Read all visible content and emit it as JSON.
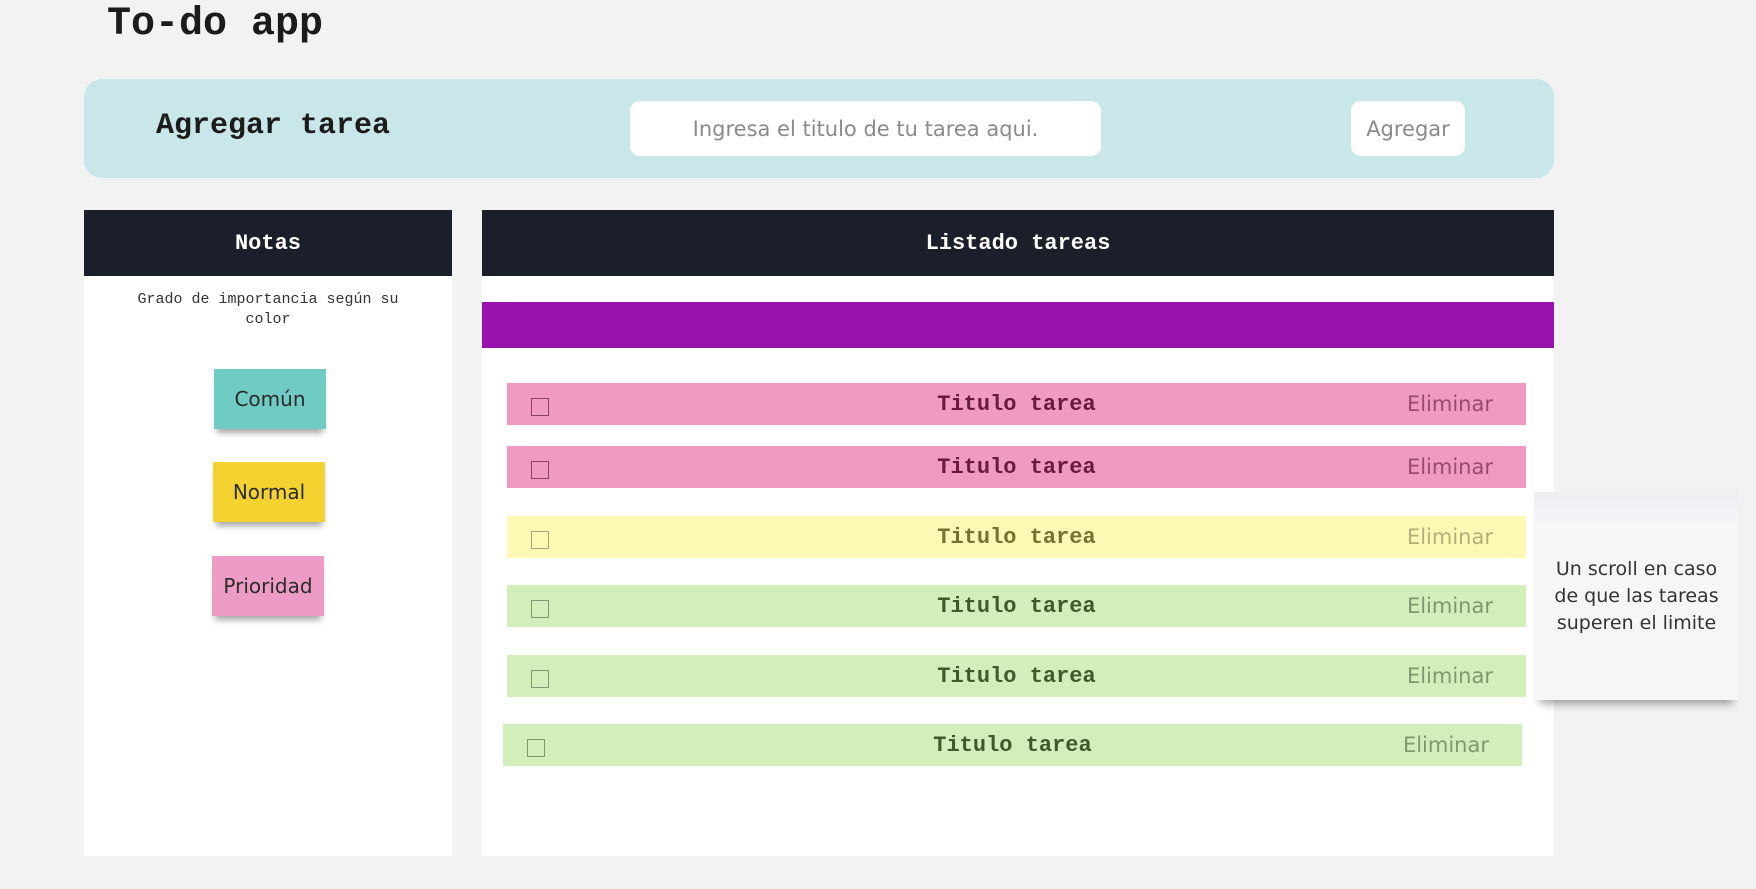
{
  "app": {
    "title": "To-do app"
  },
  "add_task": {
    "label": "Agregar tarea",
    "input_placeholder": "Ingresa el titulo de tu tarea aqui.",
    "input_value": "",
    "button_label": "Agregar"
  },
  "notes": {
    "header": "Notas",
    "description": "Grado de importancia según su color",
    "legend": [
      {
        "label": "Común",
        "color": "#6fcbc3"
      },
      {
        "label": "Normal",
        "color": "#f4d330"
      },
      {
        "label": "Prioridad",
        "color": "#ec9cc4"
      }
    ]
  },
  "tasks": {
    "header": "Listado tareas",
    "accent_color": "#9812ad",
    "items": [
      {
        "title": "Titulo tarea",
        "delete_label": "Eliminar",
        "priority": "Prioridad",
        "color": "#f09ac2",
        "checked": false
      },
      {
        "title": "Titulo tarea",
        "delete_label": "Eliminar",
        "priority": "Prioridad",
        "color": "#f09ac2",
        "checked": false
      },
      {
        "title": "Titulo tarea",
        "delete_label": "Eliminar",
        "priority": "Normal",
        "color": "#fdf9b4",
        "checked": false
      },
      {
        "title": "Titulo tarea",
        "delete_label": "Eliminar",
        "priority": "Común",
        "color": "#d2eebb",
        "checked": false
      },
      {
        "title": "Titulo tarea",
        "delete_label": "Eliminar",
        "priority": "Común",
        "color": "#d2eebb",
        "checked": false
      },
      {
        "title": "Titulo tarea",
        "delete_label": "Eliminar",
        "priority": "Común",
        "color": "#d2eebb",
        "checked": false
      }
    ]
  },
  "annotation": {
    "text": "Un scroll en caso de que las tareas superen el limite"
  }
}
